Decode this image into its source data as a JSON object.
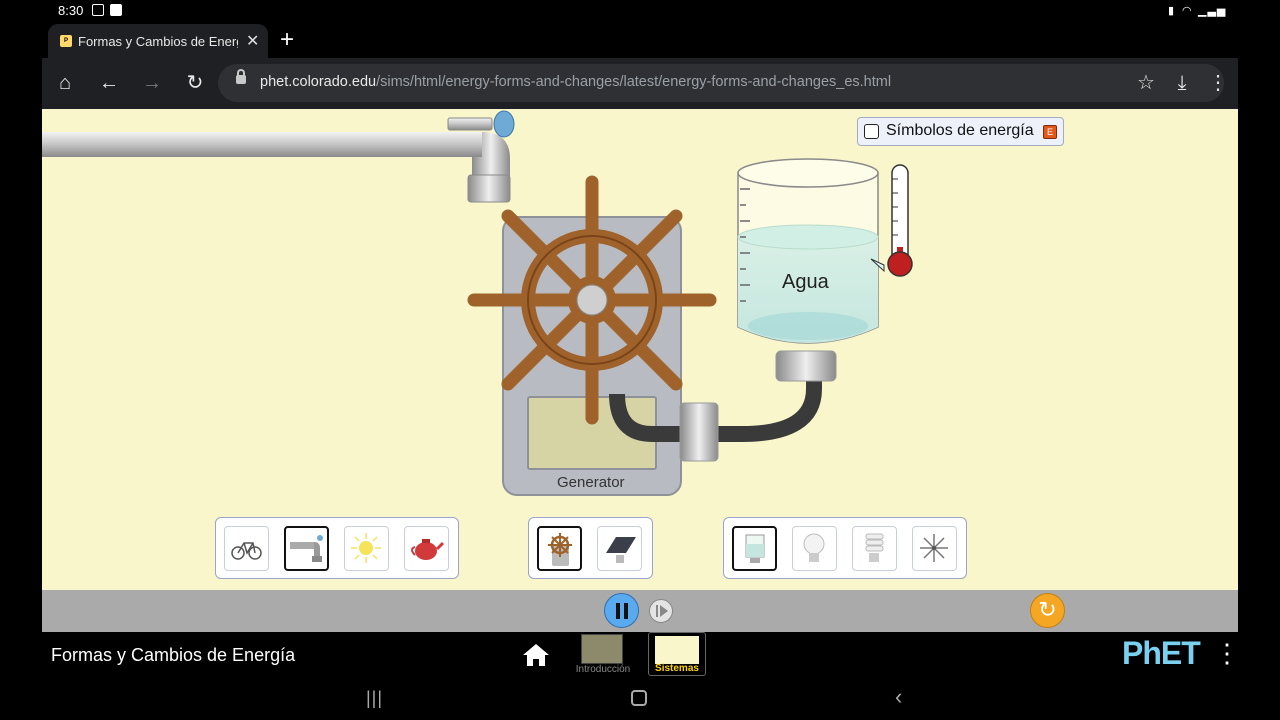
{
  "status_bar": {
    "time": "8:30"
  },
  "browser": {
    "tab_title": "Formas y Cambios de Energía",
    "new_tab": "+",
    "url_host": "phet.colorado.edu",
    "url_path": "/sims/html/energy-forms-and-changes/latest/energy-forms-and-changes_es.html"
  },
  "sim": {
    "energy_symbols_label": "Símbolos de energía",
    "energy_symbols_checked": false,
    "beaker_label": "Agua",
    "generator_label": "Generator",
    "sources": [
      {
        "name": "bicycle",
        "selected": false
      },
      {
        "name": "faucet",
        "selected": true
      },
      {
        "name": "sun",
        "selected": false
      },
      {
        "name": "teapot",
        "selected": false
      }
    ],
    "converters": [
      {
        "name": "generator",
        "selected": true
      },
      {
        "name": "solar-panel",
        "selected": false
      }
    ],
    "users": [
      {
        "name": "beaker",
        "selected": true
      },
      {
        "name": "incandescent-bulb",
        "selected": false
      },
      {
        "name": "fluorescent-bulb",
        "selected": false
      },
      {
        "name": "fan",
        "selected": false
      }
    ]
  },
  "nav": {
    "sim_title": "Formas y Cambios de Energía",
    "screens": [
      {
        "label": "Introducción",
        "selected": false
      },
      {
        "label": "Sistemas",
        "selected": true
      }
    ],
    "brand": "PhET"
  },
  "colors": {
    "sim_background": "#f9f6cb",
    "control_bar": "#aaaaaa",
    "play_button": "#5aaaf0",
    "reset_button": "#f5a623",
    "wheel": "#a0622b"
  }
}
